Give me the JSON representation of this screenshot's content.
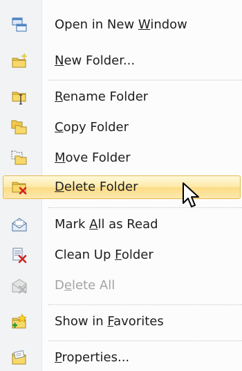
{
  "menu": {
    "items": [
      {
        "label_parts": [
          "Open in New ",
          "W",
          "indow"
        ],
        "icon": "open-new-window-icon",
        "enabled": true
      },
      {
        "label_parts": [
          "",
          "N",
          "ew Folder..."
        ],
        "icon": "new-folder-icon",
        "enabled": true
      },
      {
        "label_parts": [
          "",
          "R",
          "ename Folder"
        ],
        "icon": "rename-folder-icon",
        "enabled": true
      },
      {
        "label_parts": [
          "",
          "C",
          "opy Folder"
        ],
        "icon": "copy-folder-icon",
        "enabled": true
      },
      {
        "label_parts": [
          "",
          "M",
          "ove Folder"
        ],
        "icon": "move-folder-icon",
        "enabled": true
      },
      {
        "label_parts": [
          "",
          "D",
          "elete Folder"
        ],
        "icon": "delete-folder-icon",
        "enabled": true,
        "hovered": true
      },
      {
        "label_parts": [
          "Mark ",
          "A",
          "ll as Read"
        ],
        "icon": "mark-all-read-icon",
        "enabled": true
      },
      {
        "label_parts": [
          "Clean Up ",
          "F",
          "older"
        ],
        "icon": "clean-up-folder-icon",
        "enabled": true
      },
      {
        "label_parts": [
          "D",
          "e",
          "lete All"
        ],
        "icon": "delete-all-icon",
        "enabled": false
      },
      {
        "label_parts": [
          "Show in ",
          "F",
          "avorites"
        ],
        "icon": "show-in-favorites-icon",
        "enabled": true
      },
      {
        "label_parts": [
          "",
          "P",
          "roperties..."
        ],
        "icon": "properties-icon",
        "enabled": true
      }
    ]
  }
}
